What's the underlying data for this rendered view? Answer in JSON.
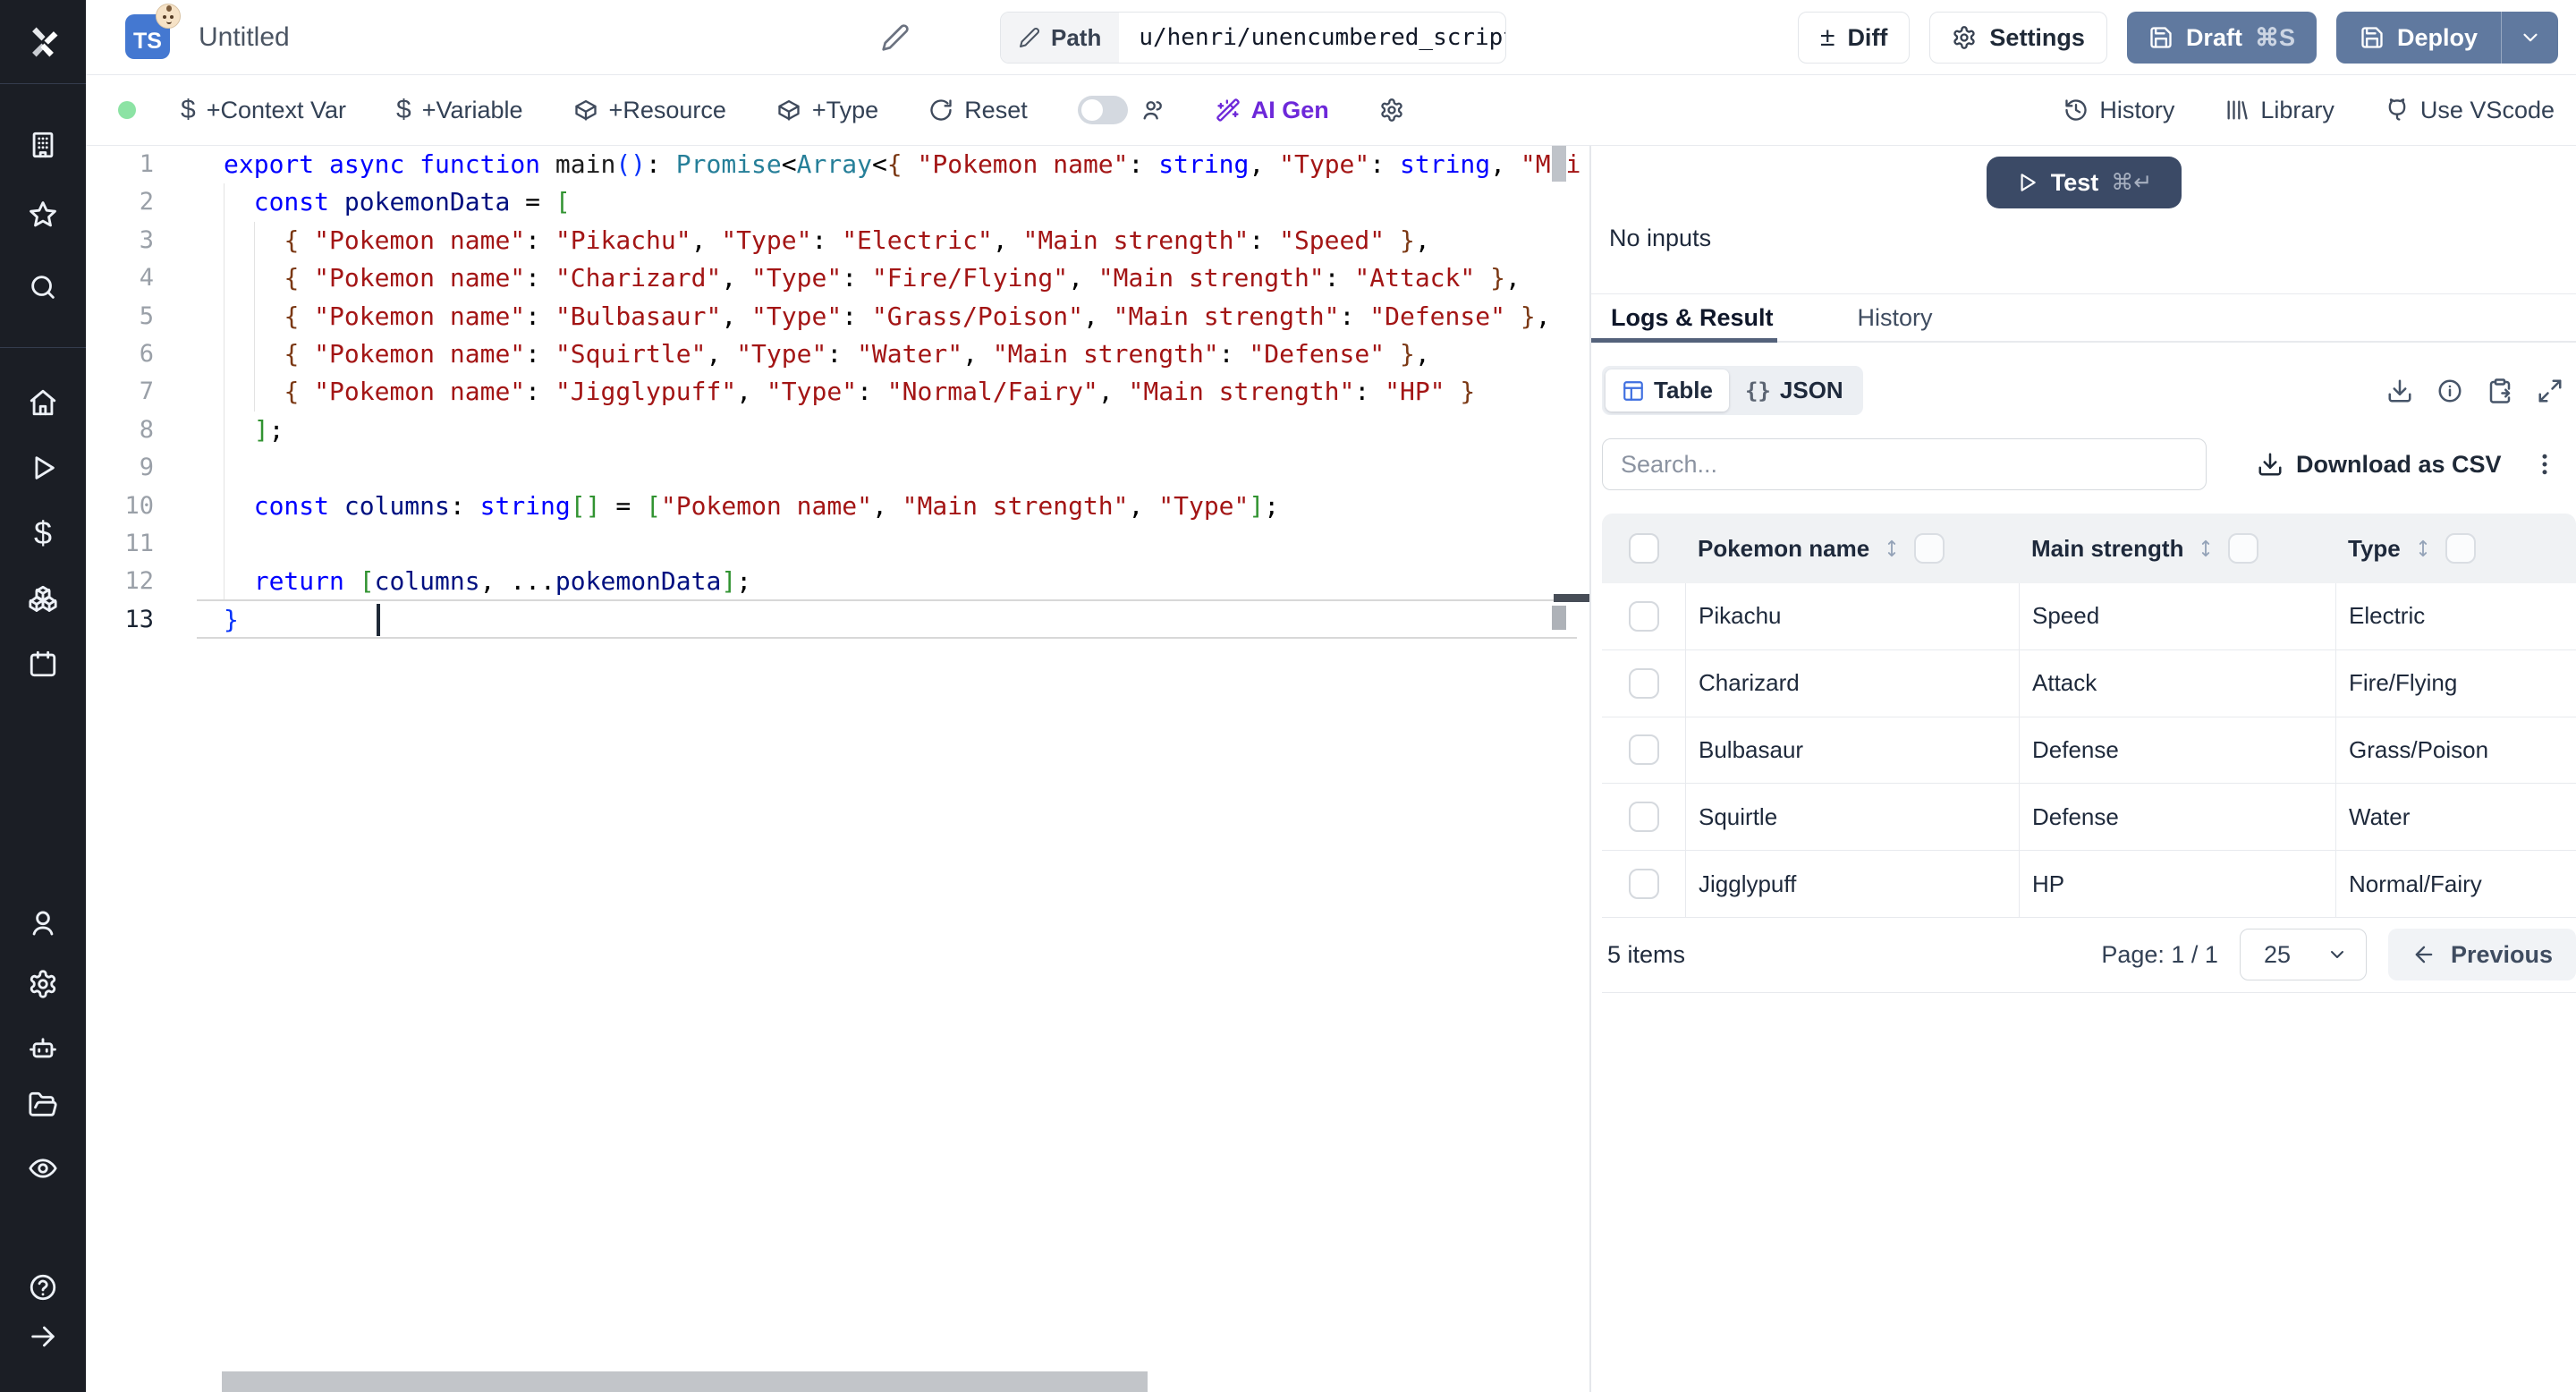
{
  "topbar": {
    "lang_badge": "TS",
    "title": "Untitled",
    "path_label": "Path",
    "path_value": "u/henri/unencumbered_script",
    "diff_label": "Diff",
    "settings_label": "Settings",
    "draft_label": "Draft",
    "draft_shortcut": "⌘S",
    "deploy_label": "Deploy"
  },
  "toolbar": {
    "context_var": "+Context Var",
    "variable": "+Variable",
    "resource": "+Resource",
    "type": "+Type",
    "reset": "Reset",
    "ai_gen": "AI Gen",
    "history": "History",
    "library": "Library",
    "use_vscode": "Use VScode"
  },
  "editor": {
    "language": "typescript",
    "active_line": 13,
    "lines": [
      [
        [
          "kw",
          "export"
        ],
        [
          "pl",
          " "
        ],
        [
          "kw",
          "async"
        ],
        [
          "pl",
          " "
        ],
        [
          "kw",
          "function"
        ],
        [
          "pl",
          " "
        ],
        [
          "fn",
          "main"
        ],
        [
          "bb",
          "()"
        ],
        [
          "pl",
          ": "
        ],
        [
          "ty",
          "Promise"
        ],
        [
          "pl",
          "<"
        ],
        [
          "ty",
          "Array"
        ],
        [
          "pl",
          "<"
        ],
        [
          "bw",
          "{"
        ],
        [
          "pl",
          " "
        ],
        [
          "st",
          "\"Pokemon name\""
        ],
        [
          "pl",
          ": "
        ],
        [
          "kw",
          "string"
        ],
        [
          "pl",
          ", "
        ],
        [
          "st",
          "\"Type\""
        ],
        [
          "pl",
          ": "
        ],
        [
          "kw",
          "string"
        ],
        [
          "pl",
          ", "
        ],
        [
          "st",
          "\"Mai"
        ]
      ],
      [
        [
          "pl",
          "  "
        ],
        [
          "kw",
          "const"
        ],
        [
          "pl",
          " "
        ],
        [
          "vr",
          "pokemonData"
        ],
        [
          "pl",
          " = "
        ],
        [
          "bg",
          "["
        ]
      ],
      [
        [
          "pl",
          "    "
        ],
        [
          "bw",
          "{"
        ],
        [
          "pl",
          " "
        ],
        [
          "st",
          "\"Pokemon name\""
        ],
        [
          "pl",
          ": "
        ],
        [
          "st",
          "\"Pikachu\""
        ],
        [
          "pl",
          ", "
        ],
        [
          "st",
          "\"Type\""
        ],
        [
          "pl",
          ": "
        ],
        [
          "st",
          "\"Electric\""
        ],
        [
          "pl",
          ", "
        ],
        [
          "st",
          "\"Main strength\""
        ],
        [
          "pl",
          ": "
        ],
        [
          "st",
          "\"Speed\""
        ],
        [
          "pl",
          " "
        ],
        [
          "bw",
          "}"
        ],
        [
          "pl",
          ","
        ]
      ],
      [
        [
          "pl",
          "    "
        ],
        [
          "bw",
          "{"
        ],
        [
          "pl",
          " "
        ],
        [
          "st",
          "\"Pokemon name\""
        ],
        [
          "pl",
          ": "
        ],
        [
          "st",
          "\"Charizard\""
        ],
        [
          "pl",
          ", "
        ],
        [
          "st",
          "\"Type\""
        ],
        [
          "pl",
          ": "
        ],
        [
          "st",
          "\"Fire/Flying\""
        ],
        [
          "pl",
          ", "
        ],
        [
          "st",
          "\"Main strength\""
        ],
        [
          "pl",
          ": "
        ],
        [
          "st",
          "\"Attack\""
        ],
        [
          "pl",
          " "
        ],
        [
          "bw",
          "}"
        ],
        [
          "pl",
          ","
        ]
      ],
      [
        [
          "pl",
          "    "
        ],
        [
          "bw",
          "{"
        ],
        [
          "pl",
          " "
        ],
        [
          "st",
          "\"Pokemon name\""
        ],
        [
          "pl",
          ": "
        ],
        [
          "st",
          "\"Bulbasaur\""
        ],
        [
          "pl",
          ", "
        ],
        [
          "st",
          "\"Type\""
        ],
        [
          "pl",
          ": "
        ],
        [
          "st",
          "\"Grass/Poison\""
        ],
        [
          "pl",
          ", "
        ],
        [
          "st",
          "\"Main strength\""
        ],
        [
          "pl",
          ": "
        ],
        [
          "st",
          "\"Defense\""
        ],
        [
          "pl",
          " "
        ],
        [
          "bw",
          "}"
        ],
        [
          "pl",
          ","
        ]
      ],
      [
        [
          "pl",
          "    "
        ],
        [
          "bw",
          "{"
        ],
        [
          "pl",
          " "
        ],
        [
          "st",
          "\"Pokemon name\""
        ],
        [
          "pl",
          ": "
        ],
        [
          "st",
          "\"Squirtle\""
        ],
        [
          "pl",
          ", "
        ],
        [
          "st",
          "\"Type\""
        ],
        [
          "pl",
          ": "
        ],
        [
          "st",
          "\"Water\""
        ],
        [
          "pl",
          ", "
        ],
        [
          "st",
          "\"Main strength\""
        ],
        [
          "pl",
          ": "
        ],
        [
          "st",
          "\"Defense\""
        ],
        [
          "pl",
          " "
        ],
        [
          "bw",
          "}"
        ],
        [
          "pl",
          ","
        ]
      ],
      [
        [
          "pl",
          "    "
        ],
        [
          "bw",
          "{"
        ],
        [
          "pl",
          " "
        ],
        [
          "st",
          "\"Pokemon name\""
        ],
        [
          "pl",
          ": "
        ],
        [
          "st",
          "\"Jigglypuff\""
        ],
        [
          "pl",
          ", "
        ],
        [
          "st",
          "\"Type\""
        ],
        [
          "pl",
          ": "
        ],
        [
          "st",
          "\"Normal/Fairy\""
        ],
        [
          "pl",
          ", "
        ],
        [
          "st",
          "\"Main strength\""
        ],
        [
          "pl",
          ": "
        ],
        [
          "st",
          "\"HP\""
        ],
        [
          "pl",
          " "
        ],
        [
          "bw",
          "}"
        ]
      ],
      [
        [
          "pl",
          "  "
        ],
        [
          "bg",
          "]"
        ],
        [
          "pl",
          ";"
        ]
      ],
      [],
      [
        [
          "pl",
          "  "
        ],
        [
          "kw",
          "const"
        ],
        [
          "pl",
          " "
        ],
        [
          "vr",
          "columns"
        ],
        [
          "pl",
          ": "
        ],
        [
          "kw",
          "string"
        ],
        [
          "bg",
          "[]"
        ],
        [
          "pl",
          " = "
        ],
        [
          "bg",
          "["
        ],
        [
          "st",
          "\"Pokemon name\""
        ],
        [
          "pl",
          ", "
        ],
        [
          "st",
          "\"Main strength\""
        ],
        [
          "pl",
          ", "
        ],
        [
          "st",
          "\"Type\""
        ],
        [
          "bg",
          "]"
        ],
        [
          "pl",
          ";"
        ]
      ],
      [],
      [
        [
          "pl",
          "  "
        ],
        [
          "kw",
          "return"
        ],
        [
          "pl",
          " "
        ],
        [
          "bg",
          "["
        ],
        [
          "vr",
          "columns"
        ],
        [
          "pl",
          ", ..."
        ],
        [
          "vr",
          "pokemonData"
        ],
        [
          "bg",
          "]"
        ],
        [
          "pl",
          ";"
        ]
      ],
      [
        [
          "bb",
          "}"
        ]
      ]
    ]
  },
  "run_panel": {
    "test_label": "Test",
    "test_shortcut": "⌘↵",
    "no_inputs": "No inputs",
    "tab_logs": "Logs & Result",
    "tab_history": "History",
    "view_table": "Table",
    "view_json": "JSON",
    "json_braces": "{}",
    "search_placeholder": "Search...",
    "download_csv": "Download as CSV",
    "table": {
      "headers": [
        "Pokemon name",
        "Main strength",
        "Type"
      ],
      "rows": [
        [
          "Pikachu",
          "Speed",
          "Electric"
        ],
        [
          "Charizard",
          "Attack",
          "Fire/Flying"
        ],
        [
          "Bulbasaur",
          "Defense",
          "Grass/Poison"
        ],
        [
          "Squirtle",
          "Defense",
          "Water"
        ],
        [
          "Jigglypuff",
          "HP",
          "Normal/Fairy"
        ]
      ]
    },
    "footer": {
      "count": "5 items",
      "page": "Page: 1 / 1",
      "page_size": "25",
      "previous": "Previous"
    }
  },
  "colors": {
    "sidebar_bg": "#1b1e25",
    "primary_button": "#60799f",
    "test_button": "#3b4a66",
    "ai_gen": "#6d28d9",
    "table_icon_blue": "#3f6fe0",
    "status_dot_green": "#8ce3a4",
    "code_keyword": "#0000ff",
    "code_type": "#267f99",
    "code_string": "#a31515"
  }
}
